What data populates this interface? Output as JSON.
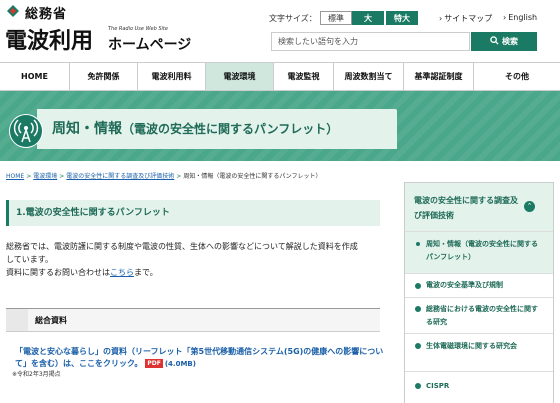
{
  "header": {
    "ministry_name": "総務省",
    "site_title": "電波利用",
    "site_title_en": "The Radio Use Web Site",
    "site_subtitle": "ホームページ",
    "font_size_label": "文字サイズ：",
    "font_size_options": [
      "標準",
      "大",
      "特大"
    ],
    "sitemap_label": "サイトマップ",
    "english_label": "English",
    "search_placeholder": "検索したい語句を入力",
    "search_button": "検索"
  },
  "nav": {
    "items": [
      "HOME",
      "免許関係",
      "電波利用料",
      "電波環境",
      "電波監視",
      "周波数割当て",
      "基準認証制度",
      "その他"
    ],
    "active": "電波環境"
  },
  "banner": {
    "title": "周知・情報",
    "subtitle": "（電波の安全性に関するパンフレット）"
  },
  "breadcrumb": {
    "items": [
      "HOME",
      "電波環境",
      "電波の安全性に関する調査及び評価技術"
    ],
    "current": "周知・情報（電波の安全性に関するパンフレット）"
  },
  "main": {
    "section_title": "1.電波の安全性に関するパンフレット",
    "intro_line1": "総務省では、電波防護に関する制度や電波の性質、生体への影響などについて解説した資料を作成",
    "intro_line2": "しています。",
    "intro_line3_prefix": "資料に関するお問い合わせは",
    "intro_line3_link": "こちら",
    "intro_line3_suffix": "まで。",
    "sub_heading": "総合資料",
    "doc_link": "「電波と安心な暮らし」の資料（リーフレット「第5世代移動通信システム(5G)の健康への影響について」を含む）は、ここをクリック。",
    "pdf_label": "PDF",
    "pdf_size": "(4.0MB)",
    "doc_date": "※令和2年3月掲点"
  },
  "side": {
    "head": "電波の安全性に関する調査及び評価技術",
    "items": [
      "周知・情報（電波の安全性に関するパンフレット）",
      "電波の安全基準及び規制",
      "総務省における電波の安全性に関する研究",
      "生体電磁環境に関する研究会",
      "CISPR"
    ]
  },
  "colors": {
    "primary_green": "#1a7a63",
    "light_green": "#e4f2ec",
    "banner_green": "#4aa78a",
    "link_blue": "#1a5fa8"
  }
}
